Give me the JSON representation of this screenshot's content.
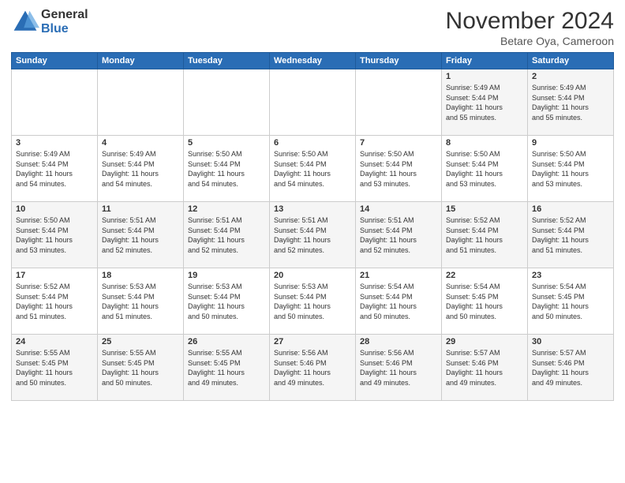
{
  "header": {
    "logo_general": "General",
    "logo_blue": "Blue",
    "month_title": "November 2024",
    "location": "Betare Oya, Cameroon"
  },
  "weekdays": [
    "Sunday",
    "Monday",
    "Tuesday",
    "Wednesday",
    "Thursday",
    "Friday",
    "Saturday"
  ],
  "weeks": [
    [
      {
        "day": "",
        "info": ""
      },
      {
        "day": "",
        "info": ""
      },
      {
        "day": "",
        "info": ""
      },
      {
        "day": "",
        "info": ""
      },
      {
        "day": "",
        "info": ""
      },
      {
        "day": "1",
        "info": "Sunrise: 5:49 AM\nSunset: 5:44 PM\nDaylight: 11 hours\nand 55 minutes."
      },
      {
        "day": "2",
        "info": "Sunrise: 5:49 AM\nSunset: 5:44 PM\nDaylight: 11 hours\nand 55 minutes."
      }
    ],
    [
      {
        "day": "3",
        "info": "Sunrise: 5:49 AM\nSunset: 5:44 PM\nDaylight: 11 hours\nand 54 minutes."
      },
      {
        "day": "4",
        "info": "Sunrise: 5:49 AM\nSunset: 5:44 PM\nDaylight: 11 hours\nand 54 minutes."
      },
      {
        "day": "5",
        "info": "Sunrise: 5:50 AM\nSunset: 5:44 PM\nDaylight: 11 hours\nand 54 minutes."
      },
      {
        "day": "6",
        "info": "Sunrise: 5:50 AM\nSunset: 5:44 PM\nDaylight: 11 hours\nand 54 minutes."
      },
      {
        "day": "7",
        "info": "Sunrise: 5:50 AM\nSunset: 5:44 PM\nDaylight: 11 hours\nand 53 minutes."
      },
      {
        "day": "8",
        "info": "Sunrise: 5:50 AM\nSunset: 5:44 PM\nDaylight: 11 hours\nand 53 minutes."
      },
      {
        "day": "9",
        "info": "Sunrise: 5:50 AM\nSunset: 5:44 PM\nDaylight: 11 hours\nand 53 minutes."
      }
    ],
    [
      {
        "day": "10",
        "info": "Sunrise: 5:50 AM\nSunset: 5:44 PM\nDaylight: 11 hours\nand 53 minutes."
      },
      {
        "day": "11",
        "info": "Sunrise: 5:51 AM\nSunset: 5:44 PM\nDaylight: 11 hours\nand 52 minutes."
      },
      {
        "day": "12",
        "info": "Sunrise: 5:51 AM\nSunset: 5:44 PM\nDaylight: 11 hours\nand 52 minutes."
      },
      {
        "day": "13",
        "info": "Sunrise: 5:51 AM\nSunset: 5:44 PM\nDaylight: 11 hours\nand 52 minutes."
      },
      {
        "day": "14",
        "info": "Sunrise: 5:51 AM\nSunset: 5:44 PM\nDaylight: 11 hours\nand 52 minutes."
      },
      {
        "day": "15",
        "info": "Sunrise: 5:52 AM\nSunset: 5:44 PM\nDaylight: 11 hours\nand 51 minutes."
      },
      {
        "day": "16",
        "info": "Sunrise: 5:52 AM\nSunset: 5:44 PM\nDaylight: 11 hours\nand 51 minutes."
      }
    ],
    [
      {
        "day": "17",
        "info": "Sunrise: 5:52 AM\nSunset: 5:44 PM\nDaylight: 11 hours\nand 51 minutes."
      },
      {
        "day": "18",
        "info": "Sunrise: 5:53 AM\nSunset: 5:44 PM\nDaylight: 11 hours\nand 51 minutes."
      },
      {
        "day": "19",
        "info": "Sunrise: 5:53 AM\nSunset: 5:44 PM\nDaylight: 11 hours\nand 50 minutes."
      },
      {
        "day": "20",
        "info": "Sunrise: 5:53 AM\nSunset: 5:44 PM\nDaylight: 11 hours\nand 50 minutes."
      },
      {
        "day": "21",
        "info": "Sunrise: 5:54 AM\nSunset: 5:44 PM\nDaylight: 11 hours\nand 50 minutes."
      },
      {
        "day": "22",
        "info": "Sunrise: 5:54 AM\nSunset: 5:45 PM\nDaylight: 11 hours\nand 50 minutes."
      },
      {
        "day": "23",
        "info": "Sunrise: 5:54 AM\nSunset: 5:45 PM\nDaylight: 11 hours\nand 50 minutes."
      }
    ],
    [
      {
        "day": "24",
        "info": "Sunrise: 5:55 AM\nSunset: 5:45 PM\nDaylight: 11 hours\nand 50 minutes."
      },
      {
        "day": "25",
        "info": "Sunrise: 5:55 AM\nSunset: 5:45 PM\nDaylight: 11 hours\nand 50 minutes."
      },
      {
        "day": "26",
        "info": "Sunrise: 5:55 AM\nSunset: 5:45 PM\nDaylight: 11 hours\nand 49 minutes."
      },
      {
        "day": "27",
        "info": "Sunrise: 5:56 AM\nSunset: 5:46 PM\nDaylight: 11 hours\nand 49 minutes."
      },
      {
        "day": "28",
        "info": "Sunrise: 5:56 AM\nSunset: 5:46 PM\nDaylight: 11 hours\nand 49 minutes."
      },
      {
        "day": "29",
        "info": "Sunrise: 5:57 AM\nSunset: 5:46 PM\nDaylight: 11 hours\nand 49 minutes."
      },
      {
        "day": "30",
        "info": "Sunrise: 5:57 AM\nSunset: 5:46 PM\nDaylight: 11 hours\nand 49 minutes."
      }
    ]
  ]
}
